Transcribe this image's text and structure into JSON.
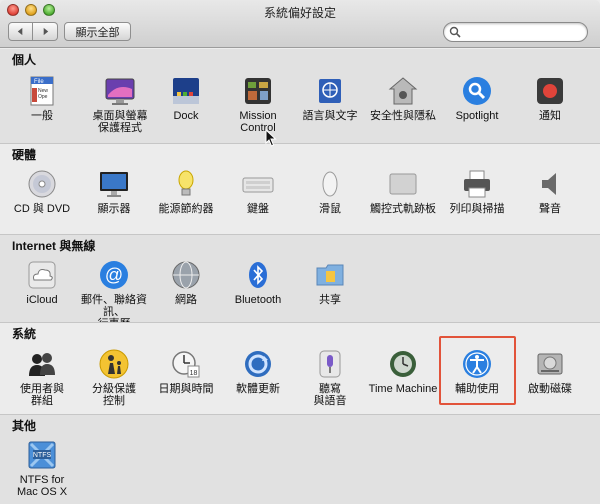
{
  "window": {
    "title": "系統偏好設定",
    "colors": {
      "highlight": "#e2533a"
    }
  },
  "toolbar": {
    "back_icon": "chevron-left-icon",
    "forward_icon": "chevron-right-icon",
    "show_all_label": "顯示全部",
    "search": {
      "value": "",
      "placeholder": ""
    }
  },
  "sections": [
    {
      "title": "個人",
      "items": [
        {
          "label": "一般",
          "icon": "general-icon"
        },
        {
          "label": "桌面與螢幕\n保護程式",
          "icon": "desktop-screensaver-icon"
        },
        {
          "label": "Dock",
          "icon": "dock-icon"
        },
        {
          "label": "Mission\nControl",
          "icon": "mission-control-icon"
        },
        {
          "label": "語言與文字",
          "icon": "language-text-icon"
        },
        {
          "label": "安全性與隱私",
          "icon": "security-privacy-icon"
        },
        {
          "label": "Spotlight",
          "icon": "spotlight-icon"
        },
        {
          "label": "通知",
          "icon": "notifications-icon"
        }
      ]
    },
    {
      "title": "硬體",
      "items": [
        {
          "label": "CD 與 DVD",
          "icon": "cd-dvd-icon"
        },
        {
          "label": "顯示器",
          "icon": "displays-icon"
        },
        {
          "label": "能源節約器",
          "icon": "energy-saver-icon"
        },
        {
          "label": "鍵盤",
          "icon": "keyboard-icon"
        },
        {
          "label": "滑鼠",
          "icon": "mouse-icon"
        },
        {
          "label": "觸控式軌跡板",
          "icon": "trackpad-icon"
        },
        {
          "label": "列印與掃描",
          "icon": "print-scan-icon"
        },
        {
          "label": "聲音",
          "icon": "sound-icon"
        }
      ]
    },
    {
      "title": "Internet 與無線",
      "items": [
        {
          "label": "iCloud",
          "icon": "icloud-icon"
        },
        {
          "label": "郵件、聯絡資訊、\n行事曆",
          "icon": "mail-contacts-calendar-icon"
        },
        {
          "label": "網路",
          "icon": "network-icon"
        },
        {
          "label": "Bluetooth",
          "icon": "bluetooth-icon"
        },
        {
          "label": "共享",
          "icon": "sharing-icon"
        }
      ]
    },
    {
      "title": "系統",
      "items": [
        {
          "label": "使用者與\n群組",
          "icon": "users-groups-icon"
        },
        {
          "label": "分級保護\n控制",
          "icon": "parental-controls-icon"
        },
        {
          "label": "日期與時間",
          "icon": "date-time-icon"
        },
        {
          "label": "軟體更新",
          "icon": "software-update-icon"
        },
        {
          "label": "聽寫\n與語音",
          "icon": "dictation-speech-icon"
        },
        {
          "label": "Time Machine",
          "icon": "time-machine-icon"
        },
        {
          "label": "輔助使用",
          "icon": "accessibility-icon"
        },
        {
          "label": "啟動磁碟",
          "icon": "startup-disk-icon"
        }
      ]
    },
    {
      "title": "其他",
      "items": [
        {
          "label": "NTFS for\nMac OS X",
          "icon": "ntfs-icon"
        }
      ]
    }
  ]
}
